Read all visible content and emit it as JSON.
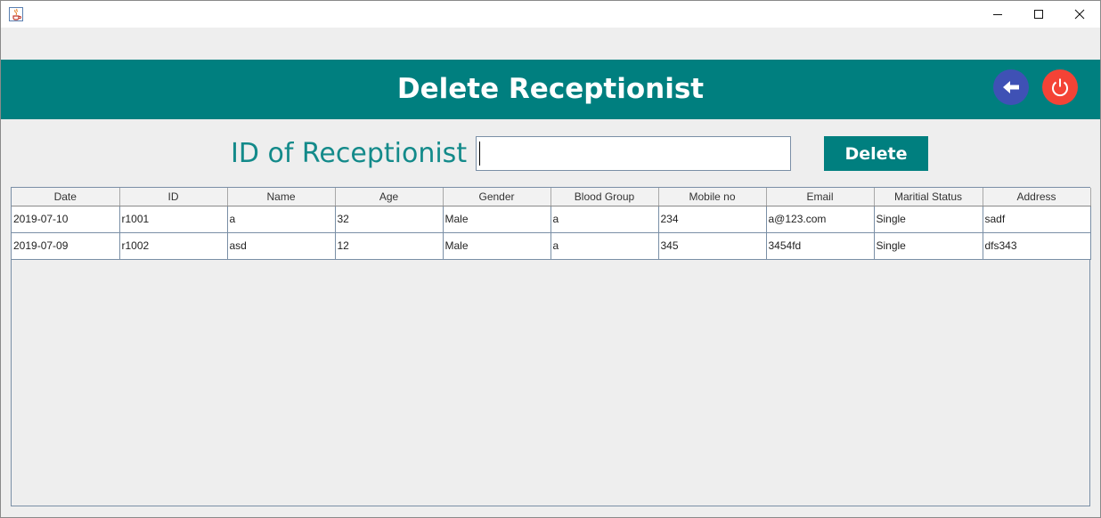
{
  "window": {
    "app_icon": "java-cup-icon",
    "controls": [
      "minimize-icon",
      "maximize-icon",
      "close-icon"
    ]
  },
  "banner": {
    "title": "Delete Receptionist",
    "back_icon": "arrow-left-icon",
    "power_icon": "power-icon",
    "color": "#007f7f"
  },
  "form": {
    "id_label": "ID of Receptionist",
    "id_value": "",
    "delete_label": "Delete"
  },
  "table": {
    "columns": [
      "Date",
      "ID",
      "Name",
      "Age",
      "Gender",
      "Blood Group",
      "Mobile no",
      "Email",
      "Maritial Status",
      "Address"
    ],
    "rows": [
      [
        "2019-07-10",
        "r1001",
        "a",
        "32",
        "Male",
        "a",
        "234",
        "a@123.com",
        "Single",
        "sadf"
      ],
      [
        "2019-07-09",
        "r1002",
        "asd",
        "12",
        "Male",
        "a",
        "345",
        "3454fd",
        "Single",
        "dfs343"
      ]
    ]
  },
  "colors": {
    "accent": "#007f7f",
    "label": "#138a8a",
    "back_button": "#3f51b5",
    "power_button": "#f44336"
  }
}
